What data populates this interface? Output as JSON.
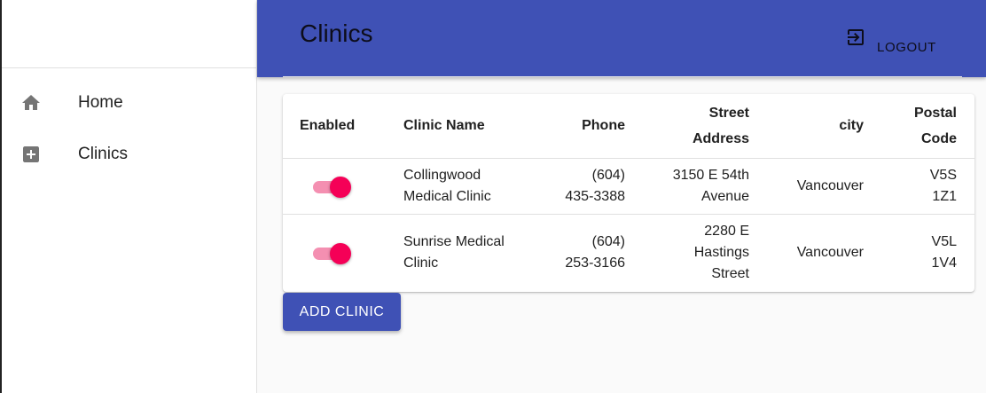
{
  "sidebar": {
    "items": [
      {
        "label": "Home",
        "icon": "home-icon"
      },
      {
        "label": "Clinics",
        "icon": "plus-box-icon"
      }
    ]
  },
  "header": {
    "title": "Clinics",
    "logout_label": "LOGOUT",
    "logout_icon": "exit-icon",
    "background": "#3f51b5"
  },
  "table": {
    "headers": {
      "enabled": "Enabled",
      "clinic_name": "Clinic Name",
      "phone": "Phone",
      "street_address": "Street Address",
      "city": "city",
      "postal_code": "Postal Code"
    },
    "rows": [
      {
        "enabled": true,
        "clinic_name": "Collingwood Medical Clinic",
        "phone": "(604) 435-3388",
        "street_address": "3150 E 54th Avenue",
        "city": "Vancouver",
        "postal_code": "V5S 1Z1"
      },
      {
        "enabled": true,
        "clinic_name": "Sunrise Medical Clinic",
        "phone": "(604) 253-3166",
        "street_address": "2280 E Hastings Street",
        "city": "Vancouver",
        "postal_code": "V5L 1V4"
      }
    ]
  },
  "add_button_label": "ADD CLINIC",
  "colors": {
    "accent": "#f50057",
    "track": "#f48fb1",
    "primary": "#3f51b5"
  }
}
